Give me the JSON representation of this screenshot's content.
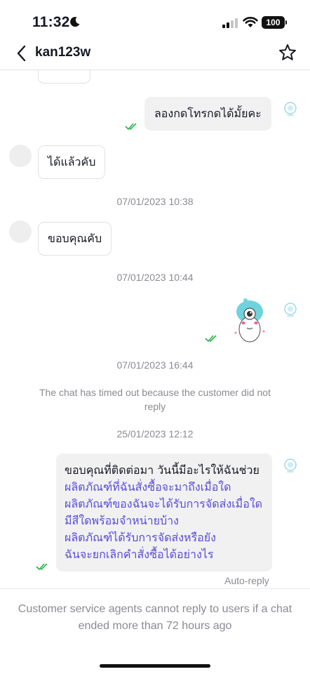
{
  "status_bar": {
    "time": "11:32",
    "battery": "100"
  },
  "header": {
    "title": "kan123w"
  },
  "messages": [
    {
      "id": "m0",
      "direction": "incoming",
      "text": "",
      "partially_visible": true
    },
    {
      "id": "m1",
      "direction": "outgoing",
      "text": "ลองกดโทรกดได้มั้ยคะ",
      "read": true
    },
    {
      "id": "m2",
      "direction": "incoming",
      "text": "ได้แล้วคับ"
    },
    {
      "id": "m3",
      "direction": "incoming",
      "text": "ขอบคุณคับ"
    },
    {
      "id": "m4",
      "direction": "outgoing",
      "type": "sticker",
      "read": true
    },
    {
      "id": "m5",
      "direction": "outgoing",
      "type": "auto-reply",
      "heading": "ขอบคุณที่ติดต่อมา วันนี้มีอะไรให้ฉันช่วย",
      "links": [
        "ผลิตภัณฑ์ที่ฉันสั่งซื้อจะมาถึงเมื่อใด",
        "ผลิตภัณฑ์ของฉันจะได้รับการจัดส่งเมื่อใด",
        "มีสีใดพร้อมจำหน่ายบ้าง",
        "ผลิตภัณฑ์ได้รับการจัดส่งหรือยัง",
        "ฉันจะยกเลิกคำสั่งซื้อได้อย่างไร"
      ],
      "read": true
    }
  ],
  "timestamps": [
    "07/01/2023 10:38",
    "07/01/2023 10:44",
    "07/01/2023 16:44",
    "25/01/2023 12:12"
  ],
  "system_notice": "The chat has timed out because the customer did not reply",
  "auto_reply_label": "Auto-reply",
  "footer_notice": "Customer service agents cannot reply to users if a chat ended more than 72 hours ago",
  "icons": {
    "back": "chevron-left-icon",
    "favorite": "star-outline-icon",
    "read_receipt": "double-check-icon",
    "shop_avatar": "shop-logo-icon",
    "sticker": "mascot-sticker"
  },
  "colors": {
    "read_receipt": "#2ab24a",
    "link": "#5a4bd8",
    "muted_text": "#8a8b91",
    "bubble_out": "#f1f1f2"
  }
}
